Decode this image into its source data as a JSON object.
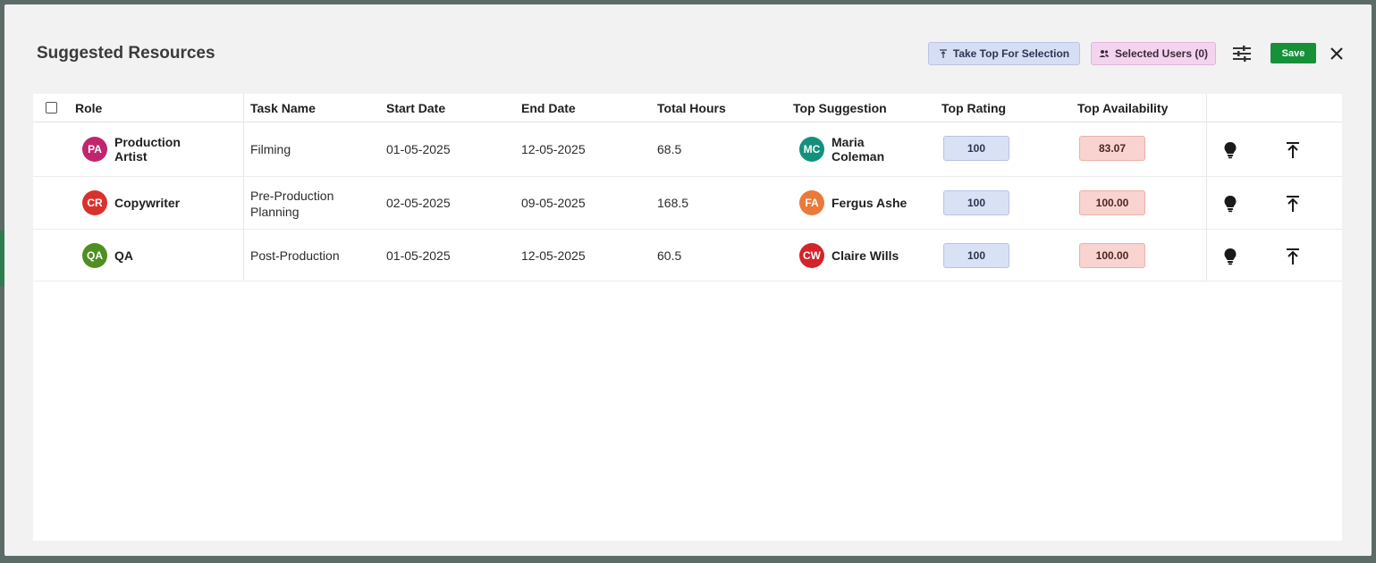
{
  "modal": {
    "title": "Suggested Resources",
    "take_top_label": "Take Top For Selection",
    "selected_users_label": "Selected Users (0)",
    "save_label": "Save"
  },
  "table": {
    "headers": {
      "role": "Role",
      "task_name": "Task Name",
      "start_date": "Start Date",
      "end_date": "End Date",
      "total_hours": "Total Hours",
      "top_suggestion": "Top Suggestion",
      "top_rating": "Top Rating",
      "top_availability": "Top Availability"
    },
    "rows": [
      {
        "role_initials": "PA",
        "role_line1": "Production",
        "role_line2": "Artist",
        "role_color": "#c2256e",
        "task_line1": "Filming",
        "task_line2": "",
        "start_date": "01-05-2025",
        "end_date": "12-05-2025",
        "total_hours": "68.5",
        "suggestion_initials": "MC",
        "suggestion_line1": "Maria",
        "suggestion_line2": "Coleman",
        "suggestion_color": "#13917d",
        "rating": "100",
        "availability": "83.07"
      },
      {
        "role_initials": "CR",
        "role_line1": "Copywriter",
        "role_line2": "",
        "role_color": "#d9322c",
        "task_line1": "Pre-Production",
        "task_line2": "Planning",
        "start_date": "02-05-2025",
        "end_date": "09-05-2025",
        "total_hours": "168.5",
        "suggestion_initials": "FA",
        "suggestion_line1": "Fergus Ashe",
        "suggestion_line2": "",
        "suggestion_color": "#ea7a3a",
        "rating": "100",
        "availability": "100.00"
      },
      {
        "role_initials": "QA",
        "role_line1": "QA",
        "role_line2": "",
        "role_color": "#4f8f22",
        "task_line1": "Post-Production",
        "task_line2": "",
        "start_date": "01-05-2025",
        "end_date": "12-05-2025",
        "total_hours": "60.5",
        "suggestion_initials": "CW",
        "suggestion_line1": "Claire Wills",
        "suggestion_line2": "",
        "suggestion_color": "#d4232a",
        "rating": "100",
        "availability": "100.00"
      }
    ]
  },
  "icons": {
    "take_top": "align-top-icon",
    "selected_users": "users-icon",
    "filter": "tune-icon",
    "close": "close-icon",
    "suggest": "lightbulb-icon",
    "move_top": "move-to-top-icon"
  }
}
